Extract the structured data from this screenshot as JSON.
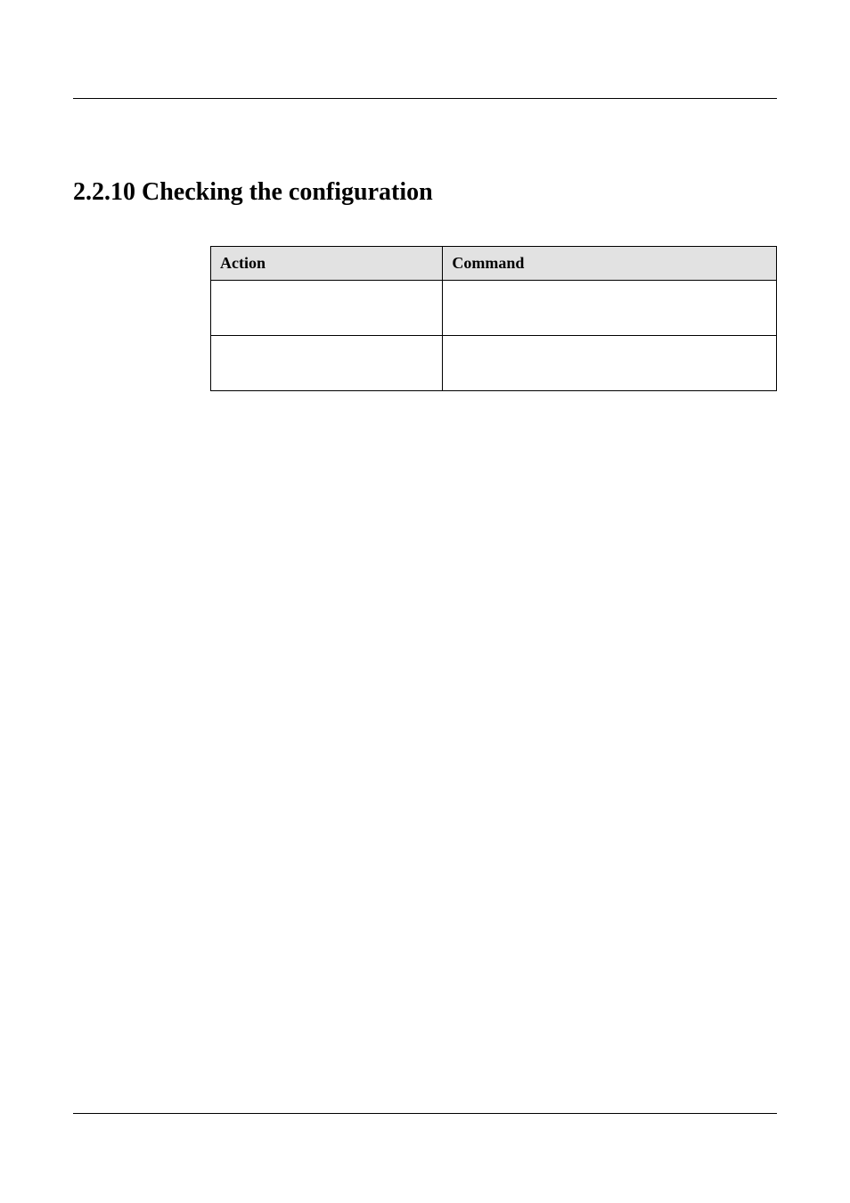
{
  "heading": "2.2.10 Checking the configuration",
  "table": {
    "headers": {
      "action": "Action",
      "command": "Command"
    },
    "rows": [
      {
        "action": "",
        "command": ""
      },
      {
        "action": "",
        "command": ""
      }
    ]
  }
}
